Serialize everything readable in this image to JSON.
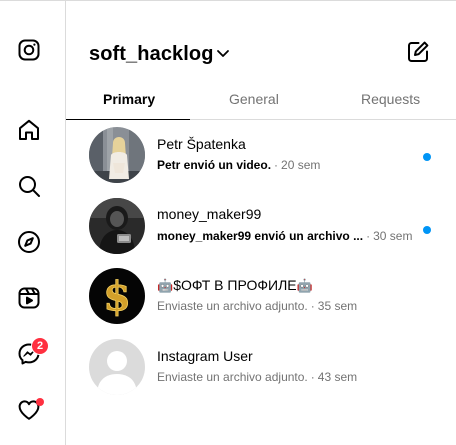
{
  "app": {
    "name": "Instagram"
  },
  "rail": {
    "items": [
      {
        "icon": "instagram-logo-icon"
      },
      {
        "icon": "home-icon"
      },
      {
        "icon": "search-icon"
      },
      {
        "icon": "explore-compass-icon"
      },
      {
        "icon": "reels-icon"
      },
      {
        "icon": "messenger-icon",
        "badge": "2"
      },
      {
        "icon": "heart-icon",
        "has_dot": true
      }
    ],
    "accent_color": "#ff3040"
  },
  "header": {
    "account_name": "soft_hacklog",
    "chevron_icon": "chevron-down-icon",
    "compose_icon": "new-message-icon"
  },
  "tabs": [
    {
      "label": "Primary",
      "active": true
    },
    {
      "label": "General",
      "active": false
    },
    {
      "label": "Requests",
      "active": false
    }
  ],
  "conversations": [
    {
      "name": "Petr Špatenka",
      "preview": "Petr envió un video.",
      "separator": "·",
      "time": "20 sem",
      "unread": true
    },
    {
      "name": "money_maker99",
      "preview": "money_maker99 envió un archivo ...",
      "separator": "·",
      "time": "30 sem",
      "unread": true
    },
    {
      "name_prefix_emoji": "🤖",
      "name": "$ОФТ В ПРОФИЛЕ",
      "name_suffix_emoji": "🤖",
      "preview": "Enviaste un archivo adjunto.",
      "separator": "·",
      "time": "35 sem",
      "unread": false
    },
    {
      "name": "Instagram User",
      "preview": "Enviaste un archivo adjunto.",
      "separator": "·",
      "time": "43 sem",
      "unread": false
    }
  ],
  "colors": {
    "unread_dot": "#0095f6",
    "secondary_text": "#737373",
    "divider": "#dbdbdb"
  }
}
